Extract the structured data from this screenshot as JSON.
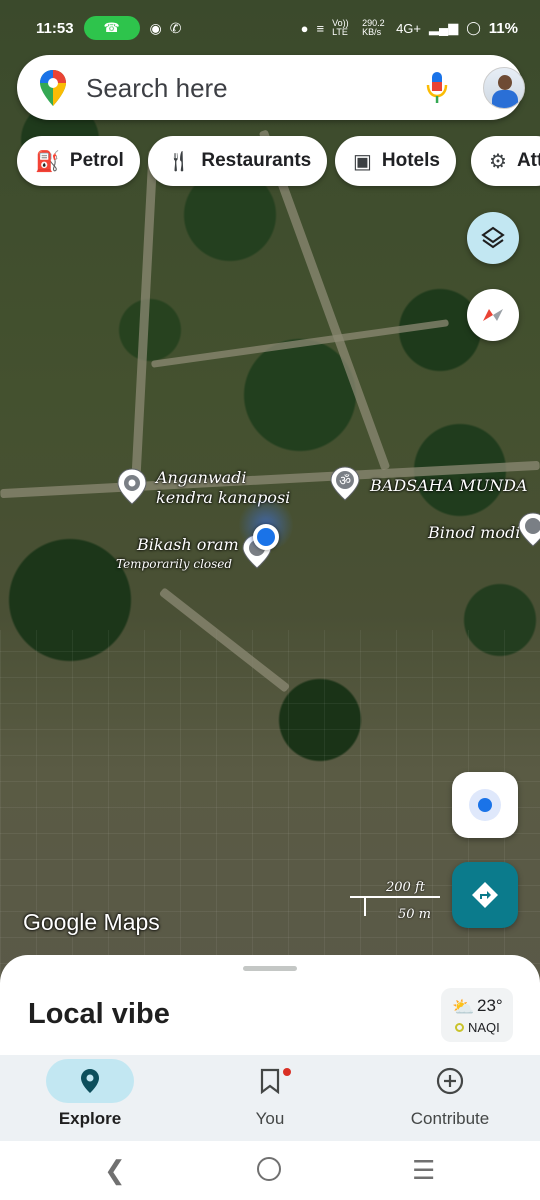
{
  "status_bar": {
    "time": "11:53",
    "network_speed": "290.2 KB/s",
    "network_type": "4G+",
    "battery": "11%",
    "carrier_tag": "Vo)) LTE"
  },
  "search": {
    "placeholder": "Search here"
  },
  "chips": [
    {
      "label": "Petrol",
      "icon": "fuel-icon"
    },
    {
      "label": "Restaurants",
      "icon": "cutlery-icon"
    },
    {
      "label": "Hotels",
      "icon": "bed-icon"
    },
    {
      "label": "Att",
      "icon": "attraction-icon"
    }
  ],
  "map": {
    "places": [
      {
        "name_line1": "Anganwadi",
        "name_line2": "kendra kanaposi"
      },
      {
        "name": "BADSAHA MUNDA"
      },
      {
        "name": "Binod modi"
      },
      {
        "name": "Bikash oram",
        "status": "Temporarily closed"
      }
    ],
    "scale": {
      "imperial": "200 ft",
      "metric": "50 m"
    },
    "watermark": "Google Maps"
  },
  "sheet": {
    "title": "Local vibe",
    "weather": {
      "temp": "23°",
      "aqi_label": "NAQI"
    }
  },
  "bottom_nav": [
    {
      "label": "Explore",
      "icon": "location-pin-icon",
      "active": true
    },
    {
      "label": "You",
      "icon": "bookmark-icon",
      "active": false
    },
    {
      "label": "Contribute",
      "icon": "add-circle-icon",
      "active": false
    }
  ],
  "colors": {
    "accent_teal": "#0b7b8c",
    "location_blue": "#1a73e8",
    "active_pill": "#c2e7f2",
    "layers_button": "#c2e7f2"
  }
}
